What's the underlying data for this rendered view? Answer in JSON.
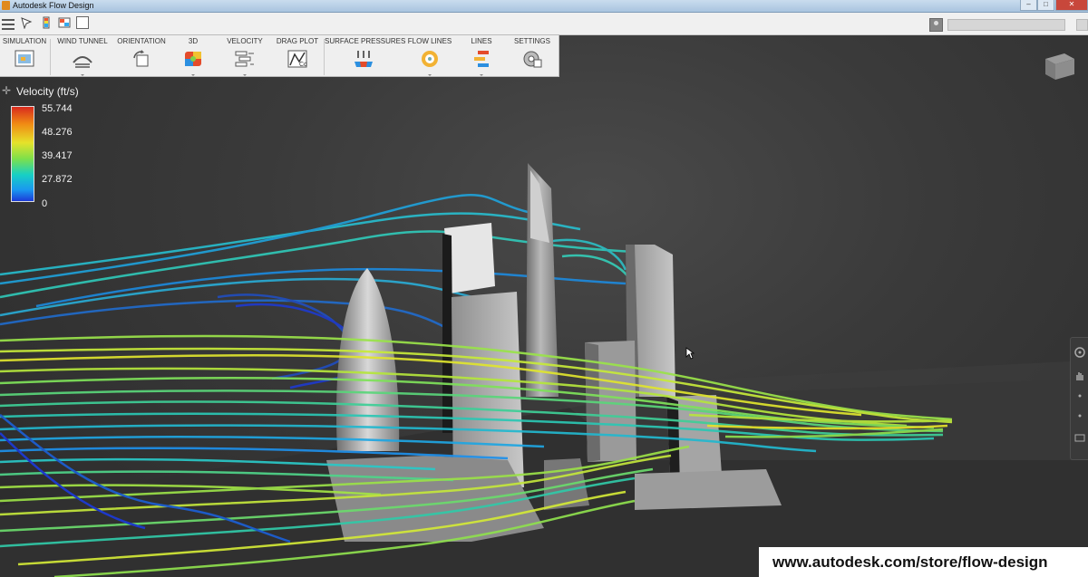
{
  "window": {
    "title": "Autodesk Flow Design",
    "minimize_glyph": "–",
    "maximize_glyph": "□",
    "close_glyph": "✕"
  },
  "quickbar": {
    "icons": [
      "hamburger-menu-icon",
      "select-icon",
      "legend-icon",
      "compare-icon",
      "window-icon"
    ]
  },
  "toolbar": {
    "tools": [
      {
        "label": "SIMULATION",
        "icon": "simulation-icon"
      },
      {
        "label": "WIND TUNNEL",
        "icon": "wind-tunnel-icon"
      },
      {
        "label": "ORIENTATION",
        "icon": "orientation-icon"
      },
      {
        "label": "3D",
        "icon": "3d-icon"
      },
      {
        "label": "VELOCITY",
        "icon": "velocity-icon"
      },
      {
        "label": "DRAG PLOT",
        "icon": "drag-plot-icon"
      },
      {
        "label": "SURFACE PRESSURES",
        "icon": "surface-pressures-icon"
      },
      {
        "label": "FLOW LINES",
        "icon": "flow-lines-icon"
      },
      {
        "label": "LINES",
        "icon": "lines-icon"
      },
      {
        "label": "SETTINGS",
        "icon": "settings-icon"
      }
    ]
  },
  "legend": {
    "title": "Velocity (ft/s)",
    "ticks": [
      "55.744",
      "48.276",
      "39.417",
      "27.872",
      "0"
    ],
    "colors": {
      "max": "#d82a1e",
      "high": "#f08a14",
      "mid_high": "#e6e22a",
      "mid": "#7ee04a",
      "mid_low": "#17d0c4",
      "low": "#1a98f0",
      "min": "#1c3ad8"
    }
  },
  "navbar": {
    "icons": [
      "steering-wheel-icon",
      "pan-hand-icon",
      "orbit-icon",
      "zoom-icon",
      "fit-view-icon"
    ]
  },
  "watermark": {
    "text": "www.autodesk.com/store/flow-design"
  }
}
